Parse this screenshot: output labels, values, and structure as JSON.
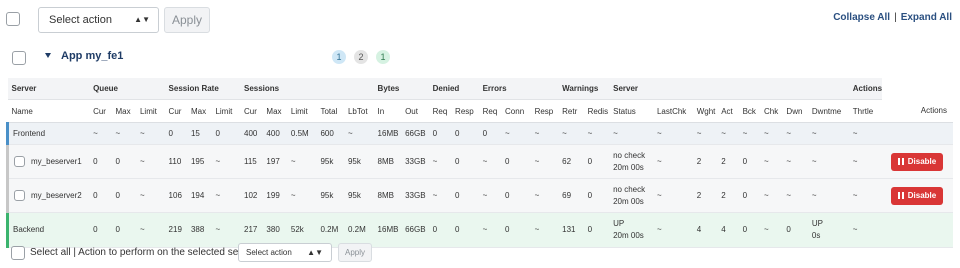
{
  "toolbar": {
    "select_placeholder": "Select action",
    "apply_label": "Apply",
    "collapse_all": "Collapse All",
    "separator": "|",
    "expand_all": "Expand All"
  },
  "proxy": {
    "name": "App my_fe1",
    "badges": [
      "1",
      "2",
      "1"
    ]
  },
  "table": {
    "groups": [
      "Server",
      "Queue",
      "Session Rate",
      "Sessions",
      "Bytes",
      "Denied",
      "Errors",
      "Warnings",
      "Server",
      "Actions"
    ],
    "columns": [
      "Name",
      "Cur",
      "Max",
      "Limit",
      "Cur",
      "Max",
      "Limit",
      "Cur",
      "Max",
      "Limit",
      "Total",
      "LbTot",
      "In",
      "Out",
      "Req",
      "Resp",
      "Req",
      "Conn",
      "Resp",
      "Retr",
      "Redis",
      "Status",
      "LastChk",
      "Wght",
      "Act",
      "Bck",
      "Chk",
      "Dwn",
      "Dwntme",
      "Thrtle",
      "Actions"
    ],
    "rows": [
      {
        "kind": "frontend",
        "cells": [
          "Frontend",
          "~",
          "~",
          "~",
          "0",
          "15",
          "0",
          "400",
          "400",
          "0.5M",
          "600",
          "~",
          "16MB",
          "66GB",
          "0",
          "0",
          "0",
          "~",
          "~",
          "~",
          "~",
          "~",
          "~",
          "~",
          "~",
          "~",
          "~",
          "~",
          "~",
          "~",
          ""
        ]
      },
      {
        "kind": "server",
        "cells": [
          "my_beserver1",
          "0",
          "0",
          "~",
          "110",
          "195",
          "~",
          "115",
          "197",
          "~",
          "95k",
          "95k",
          "8MB",
          "33GB",
          "~",
          "0",
          "~",
          "0",
          "~",
          "62",
          "0",
          "no check\n20m 00s",
          "~",
          "2",
          "2",
          "0",
          "~",
          "~",
          "~",
          "~",
          "Disable"
        ]
      },
      {
        "kind": "server",
        "cells": [
          "my_beserver2",
          "0",
          "0",
          "~",
          "106",
          "194",
          "~",
          "102",
          "199",
          "~",
          "95k",
          "95k",
          "8MB",
          "33GB",
          "~",
          "0",
          "~",
          "0",
          "~",
          "69",
          "0",
          "no check\n20m 00s",
          "~",
          "2",
          "2",
          "0",
          "~",
          "~",
          "~",
          "~",
          "Disable"
        ]
      },
      {
        "kind": "backend",
        "cells": [
          "Backend",
          "0",
          "0",
          "~",
          "219",
          "388",
          "~",
          "217",
          "380",
          "52k",
          "0.2M",
          "0.2M",
          "16MB",
          "66GB",
          "0",
          "0",
          "~",
          "0",
          "~",
          "131",
          "0",
          "UP\n20m 00s",
          "~",
          "4",
          "4",
          "0",
          "~",
          "0",
          "UP\n0s",
          "~",
          ""
        ]
      }
    ]
  },
  "bottom": {
    "select_all_text": "Select all | Action to perform on the selected servers:",
    "select_placeholder": "Select action",
    "apply_label": "Apply"
  }
}
